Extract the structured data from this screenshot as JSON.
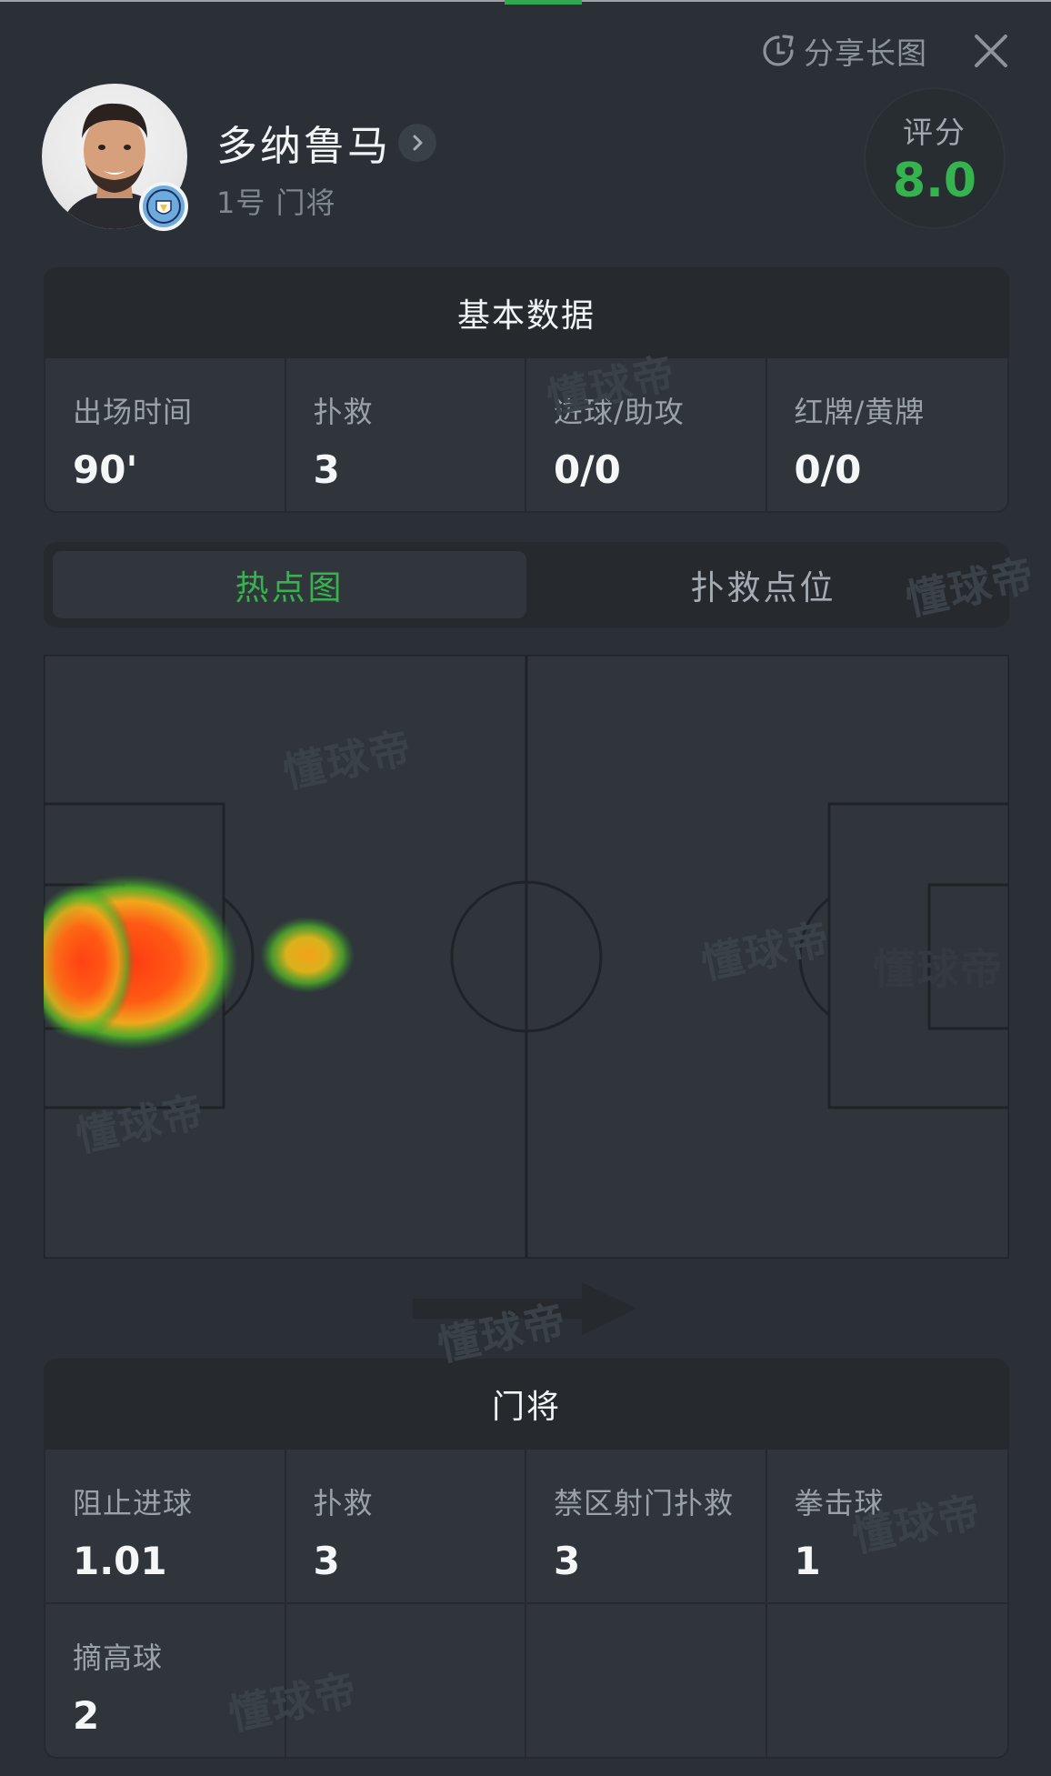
{
  "header": {
    "share_label": "分享长图",
    "close_icon": "close-icon",
    "share_icon": "share-refresh-icon"
  },
  "player": {
    "name": "多纳鲁马",
    "subtitle": "1号 门将",
    "rating_label": "评分",
    "rating_value": "8.0",
    "club": "Manchester City"
  },
  "basic_stats": {
    "title": "基本数据",
    "items": [
      {
        "label": "出场时间",
        "value": "90'"
      },
      {
        "label": "扑救",
        "value": "3"
      },
      {
        "label": "进球/助攻",
        "value": "0/0"
      },
      {
        "label": "红牌/黄牌",
        "value": "0/0"
      }
    ]
  },
  "tabs": [
    {
      "label": "热点图",
      "active": true
    },
    {
      "label": "扑救点位",
      "active": false
    }
  ],
  "heatmap": {
    "attack_direction": "right"
  },
  "goalkeeper_stats": {
    "title": "门将",
    "items": [
      {
        "label": "阻止进球",
        "value": "1.01"
      },
      {
        "label": "扑救",
        "value": "3"
      },
      {
        "label": "禁区射门扑救",
        "value": "3"
      },
      {
        "label": "拳击球",
        "value": "1"
      },
      {
        "label": "摘高球",
        "value": "2"
      }
    ]
  },
  "watermark": "懂球帝",
  "colors": {
    "background": "#2b3036",
    "accent_green": "#34b34f",
    "card": "#2f353b",
    "card_head": "#262a2f"
  }
}
